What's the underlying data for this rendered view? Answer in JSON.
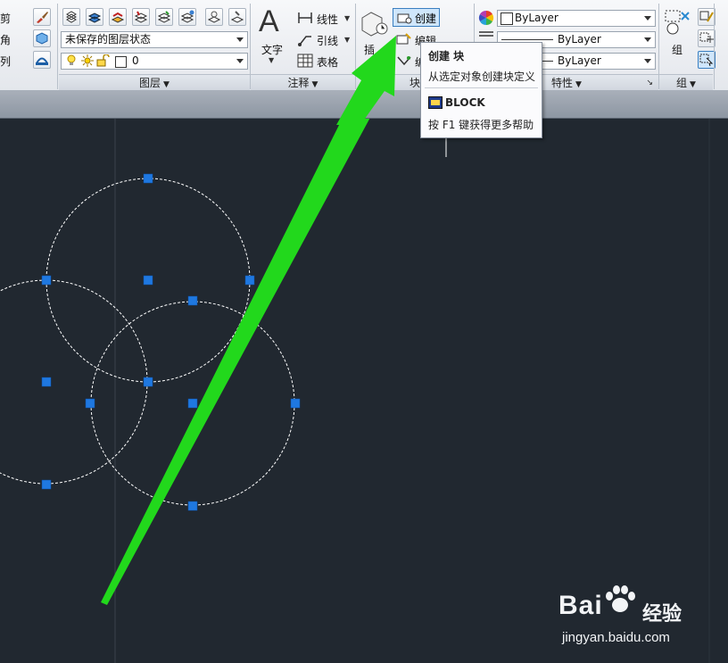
{
  "ribbon": {
    "modify": {
      "labels": [
        "剪",
        "角",
        "列"
      ]
    },
    "layers": {
      "layer_state": "未保存的图层状态",
      "current_layer": "0",
      "title": "图层"
    },
    "annotation": {
      "text_label": "文字",
      "linear_label": "线性",
      "leader_label": "引线",
      "table_label": "表格",
      "title": "注释"
    },
    "block": {
      "insert_label": "插",
      "create_label": "创建",
      "edit_label": "编辑",
      "edit_attr_label": "编",
      "title": "块"
    },
    "properties": {
      "color": "ByLayer",
      "linetype": "ByLayer",
      "lineweight": "ByLayer",
      "title": "特性"
    },
    "groups": {
      "group_label": "组",
      "title": "组"
    }
  },
  "tooltip": {
    "title": "创建 块",
    "description": "从选定对象创建块定义",
    "command": "BLOCK",
    "help": "按 F1 键获得更多帮助"
  },
  "watermark": {
    "logo": "Bai",
    "logo_suffix": "经验",
    "url": "jingyan.baidu.com"
  },
  "colors": {
    "canvas_bg": "#212830",
    "grip": "#1f78e0",
    "arrow": "#22d81c",
    "selection_dashes": "#ffffff",
    "create_highlight": "#cfe6fb"
  },
  "icons": [
    "brush-icon",
    "layer-icon",
    "lightbulb-icon",
    "sun-icon",
    "lock-icon",
    "text-A-icon",
    "linear-dim-icon",
    "leader-icon",
    "table-icon",
    "insert-block-icon",
    "create-block-icon",
    "edit-block-icon",
    "color-wheel-icon",
    "group-icon"
  ]
}
